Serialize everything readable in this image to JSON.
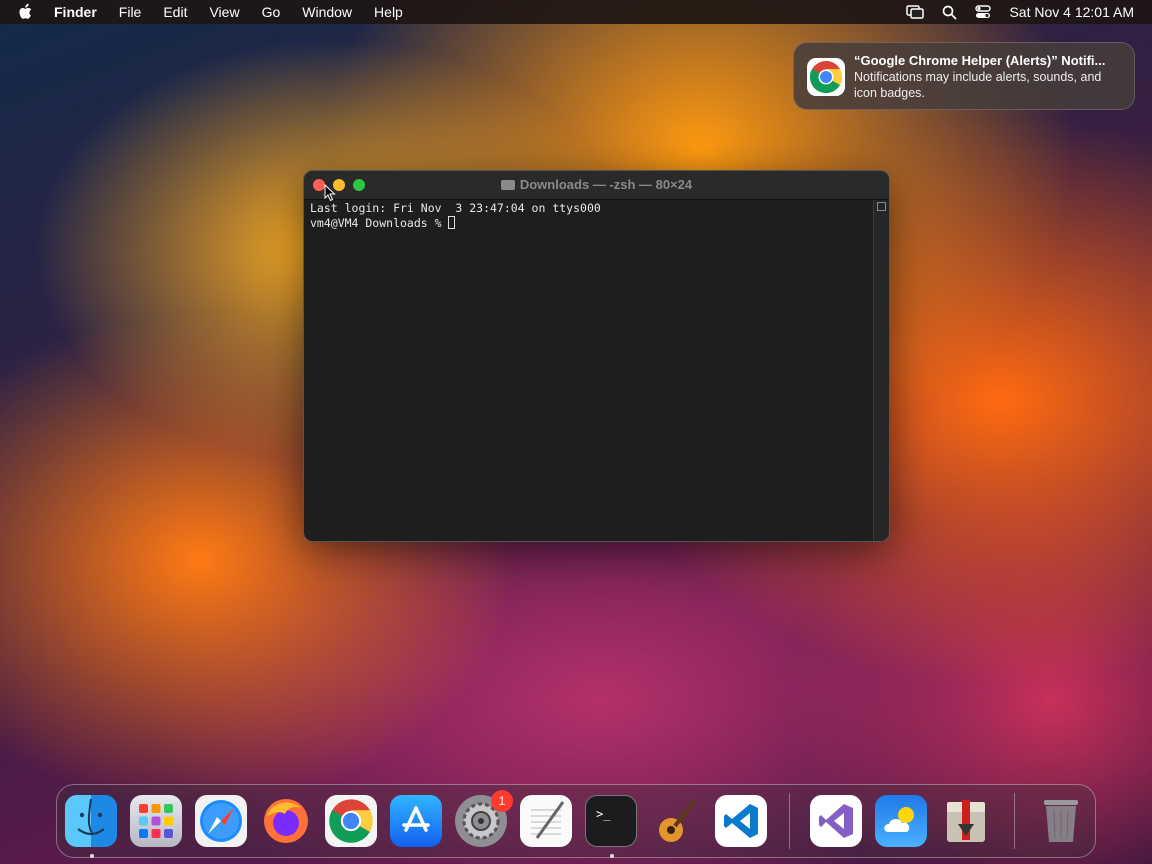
{
  "menubar": {
    "apple_icon": "apple-logo-icon",
    "app_name": "Finder",
    "items": [
      "File",
      "Edit",
      "View",
      "Go",
      "Window",
      "Help"
    ],
    "status_icons": [
      "screen-mirroring-icon",
      "spotlight-search-icon",
      "control-center-icon"
    ],
    "clock": "Sat Nov 4  12:01 AM"
  },
  "notification": {
    "app_icon": "chrome-icon",
    "title": "“Google Chrome Helper (Alerts)” Notifi...",
    "body": "Notifications may include alerts, sounds, and icon badges."
  },
  "terminal": {
    "title": "Downloads — -zsh — 80×24",
    "lines": [
      "Last login: Fri Nov  3 23:47:04 on ttys000",
      "vm4@VM4 Downloads % "
    ]
  },
  "dock": {
    "apps": [
      {
        "name": "Finder",
        "icon": "finder-icon",
        "running": true
      },
      {
        "name": "Launchpad",
        "icon": "launchpad-icon",
        "running": false
      },
      {
        "name": "Safari",
        "icon": "safari-icon",
        "running": false
      },
      {
        "name": "Firefox",
        "icon": "firefox-icon",
        "running": false
      },
      {
        "name": "Google Chrome",
        "icon": "chrome-icon",
        "running": false
      },
      {
        "name": "App Store",
        "icon": "app-store-icon",
        "running": false
      },
      {
        "name": "System Settings",
        "icon": "system-settings-icon",
        "running": false,
        "badge": "1"
      },
      {
        "name": "TextEdit",
        "icon": "textedit-icon",
        "running": false
      },
      {
        "name": "Terminal",
        "icon": "terminal-icon",
        "running": true
      },
      {
        "name": "GarageBand",
        "icon": "garageband-icon",
        "running": false
      },
      {
        "name": "Visual Studio Code",
        "icon": "vscode-icon",
        "running": false
      },
      {
        "name": "Visual Studio",
        "icon": "visual-studio-icon",
        "running": false
      },
      {
        "name": "Weather",
        "icon": "weather-icon",
        "running": false
      },
      {
        "name": "Installer",
        "icon": "installer-icon",
        "running": false
      },
      {
        "name": "Trash",
        "icon": "trash-icon",
        "running": false
      }
    ]
  }
}
